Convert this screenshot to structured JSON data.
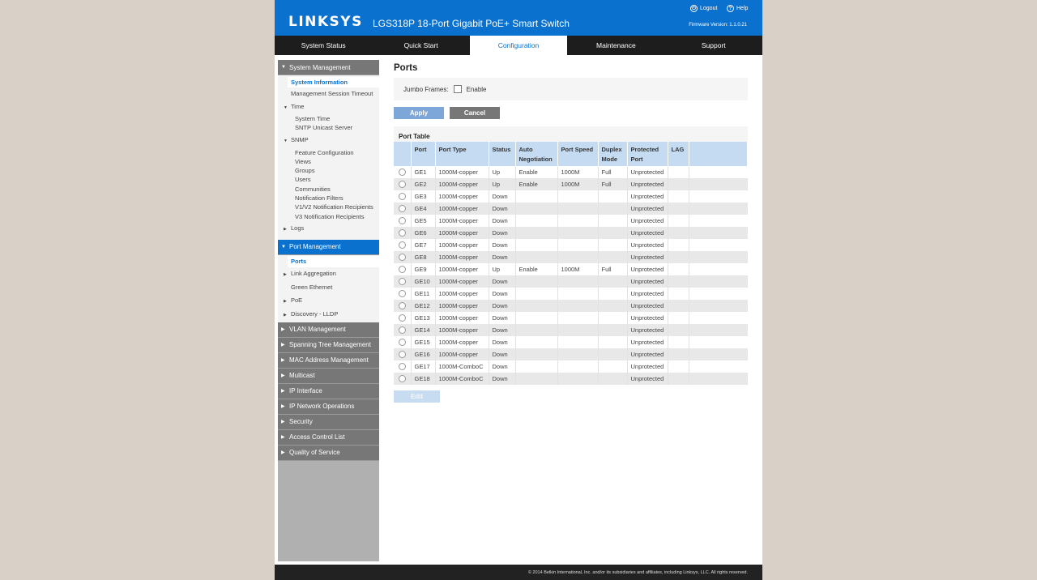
{
  "header": {
    "brand": "LINKSYS",
    "product": "LGS318P 18-Port Gigabit PoE+ Smart Switch",
    "logout": "Logout",
    "help": "Help",
    "firmware": "Firmware Version: 1.1.0.21"
  },
  "topnav": [
    "System Status",
    "Quick Start",
    "Configuration",
    "Maintenance",
    "Support"
  ],
  "sidebar": {
    "system_management": "System Management",
    "system_information": "System Information",
    "management_session_timeout": "Management Session Timeout",
    "time": "Time",
    "system_time": "System Time",
    "sntp_unicast_server": "SNTP Unicast Server",
    "snmp": "SNMP",
    "feature_configuration": "Feature Configuration",
    "views": "Views",
    "groups": "Groups",
    "users": "Users",
    "communities": "Communities",
    "notification_filters": "Notification Filters",
    "v1v2_notification_recipients": "V1/V2 Notification Recipients",
    "v3_notification_recipients": "V3 Notification Recipients",
    "logs": "Logs",
    "port_management": "Port Management",
    "ports": "Ports",
    "link_aggregation": "Link Aggregation",
    "green_ethernet": "Green Ethernet",
    "poe": "PoE",
    "discovery_lldp": "Discovery - LLDP",
    "vlan_management": "VLAN Management",
    "spanning_tree_management": "Spanning Tree Management",
    "mac_address_management": "MAC Address Management",
    "multicast": "Multicast",
    "ip_interface": "IP Interface",
    "ip_network_operations": "IP Network Operations",
    "security": "Security",
    "access_control_list": "Access Control List",
    "quality_of_service": "Quality of Service"
  },
  "main": {
    "title": "Ports",
    "jumbo_label": "Jumbo Frames:",
    "enable_label": "Enable",
    "apply": "Apply",
    "cancel": "Cancel",
    "table_title": "Port Table",
    "edit": "Edit",
    "columns": {
      "port": "Port",
      "port_type": "Port Type",
      "status": "Status",
      "auto_neg_1": "Auto",
      "auto_neg_2": "Negotiation",
      "port_speed": "Port Speed",
      "duplex_1": "Duplex",
      "duplex_2": "Mode",
      "protected_1": "Protected",
      "protected_2": "Port",
      "lag": "LAG"
    },
    "rows": [
      [
        "GE1",
        "1000M-copper",
        "Up",
        "Enable",
        "1000M",
        "Full",
        "Unprotected",
        ""
      ],
      [
        "GE2",
        "1000M-copper",
        "Up",
        "Enable",
        "1000M",
        "Full",
        "Unprotected",
        ""
      ],
      [
        "GE3",
        "1000M-copper",
        "Down",
        "",
        "",
        "",
        "Unprotected",
        ""
      ],
      [
        "GE4",
        "1000M-copper",
        "Down",
        "",
        "",
        "",
        "Unprotected",
        ""
      ],
      [
        "GE5",
        "1000M-copper",
        "Down",
        "",
        "",
        "",
        "Unprotected",
        ""
      ],
      [
        "GE6",
        "1000M-copper",
        "Down",
        "",
        "",
        "",
        "Unprotected",
        ""
      ],
      [
        "GE7",
        "1000M-copper",
        "Down",
        "",
        "",
        "",
        "Unprotected",
        ""
      ],
      [
        "GE8",
        "1000M-copper",
        "Down",
        "",
        "",
        "",
        "Unprotected",
        ""
      ],
      [
        "GE9",
        "1000M-copper",
        "Up",
        "Enable",
        "1000M",
        "Full",
        "Unprotected",
        ""
      ],
      [
        "GE10",
        "1000M-copper",
        "Down",
        "",
        "",
        "",
        "Unprotected",
        ""
      ],
      [
        "GE11",
        "1000M-copper",
        "Down",
        "",
        "",
        "",
        "Unprotected",
        ""
      ],
      [
        "GE12",
        "1000M-copper",
        "Down",
        "",
        "",
        "",
        "Unprotected",
        ""
      ],
      [
        "GE13",
        "1000M-copper",
        "Down",
        "",
        "",
        "",
        "Unprotected",
        ""
      ],
      [
        "GE14",
        "1000M-copper",
        "Down",
        "",
        "",
        "",
        "Unprotected",
        ""
      ],
      [
        "GE15",
        "1000M-copper",
        "Down",
        "",
        "",
        "",
        "Unprotected",
        ""
      ],
      [
        "GE16",
        "1000M-copper",
        "Down",
        "",
        "",
        "",
        "Unprotected",
        ""
      ],
      [
        "GE17",
        "1000M-ComboC",
        "Down",
        "",
        "",
        "",
        "Unprotected",
        ""
      ],
      [
        "GE18",
        "1000M-ComboC",
        "Down",
        "",
        "",
        "",
        "Unprotected",
        ""
      ]
    ]
  },
  "footer": "© 2014 Belkin International, Inc. and/or its subsidiaries and affiliates, including Linksys, LLC. All rights reserved.",
  "colors": {
    "brand_blue": "#0a71cf",
    "nav_dark": "#1d1d1d",
    "header_row": "#c4dbf2"
  }
}
